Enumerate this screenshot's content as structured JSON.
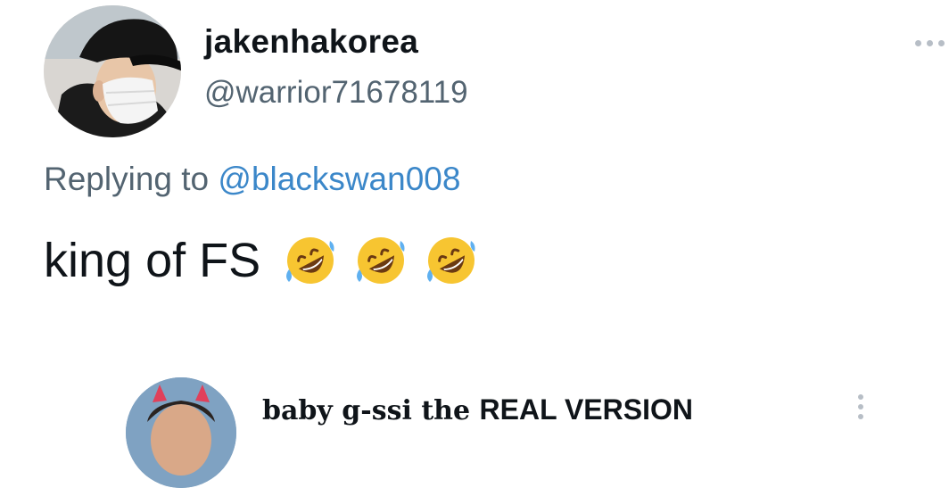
{
  "tweet": {
    "avatar_icon": "user-avatar",
    "display_name": "jakenhakorea",
    "handle": "@warrior71678119",
    "more_icon": "more-horizontal-icon",
    "reply_prefix": "Replying to ",
    "reply_mention": "@blackswan008",
    "text": "king of FS",
    "emojis": [
      "🤣",
      "🤣",
      "🤣"
    ],
    "emoji_name": "rolling-on-the-floor-laughing"
  },
  "next_tweet": {
    "avatar_icon": "user-avatar",
    "display_name_serif": "baby g-ssi the ",
    "display_name_sans": "REAL VERSION",
    "more_icon": "more-vertical-icon"
  },
  "colors": {
    "text_primary": "#0f1419",
    "text_secondary": "#536471",
    "mention": "#3b87c9",
    "dots": "#b7bec6"
  }
}
